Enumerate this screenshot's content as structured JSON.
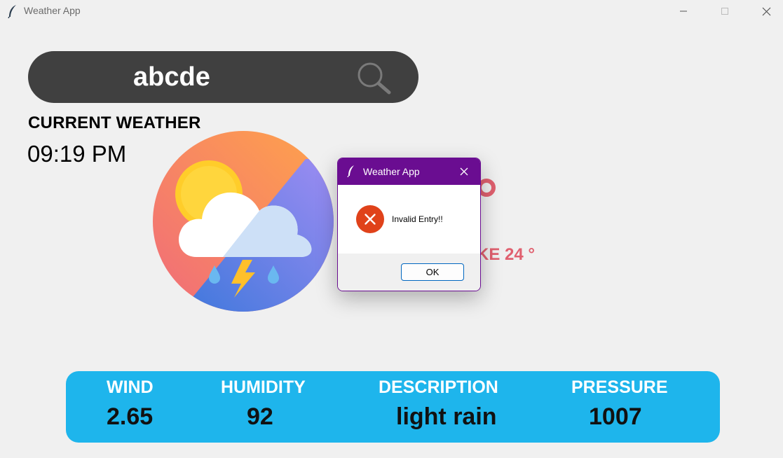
{
  "window": {
    "title": "Weather App",
    "icons": [
      "feather-icon",
      "minimize-icon",
      "maximize-icon",
      "close-icon"
    ]
  },
  "search": {
    "value": "abcde",
    "icon": "search-icon"
  },
  "current": {
    "heading": "CURRENT WEATHER",
    "time": "09:19 PM",
    "feels_like": "KE 24 °"
  },
  "stats": {
    "wind_label": "WIND",
    "wind_value": "2.65",
    "humidity_label": "HUMIDITY",
    "humidity_value": "92",
    "description_label": "DESCRIPTION",
    "description_value": "light rain",
    "pressure_label": "PRESSURE",
    "pressure_value": "1007"
  },
  "dialog": {
    "title": "Weather App",
    "message": "Invalid Entry!!",
    "ok_label": "OK",
    "icon": "error-icon"
  },
  "colors": {
    "accent": "#1eb5ec",
    "search_bar": "#404040",
    "dialog_title": "#6a0d91",
    "feels_like": "#e0606f",
    "error": "#e0421a"
  }
}
